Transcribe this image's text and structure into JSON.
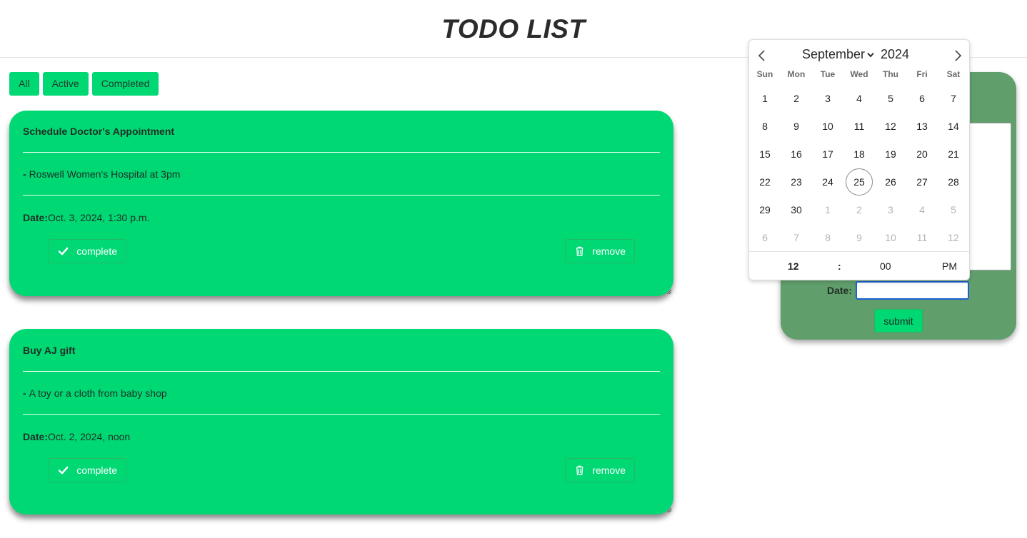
{
  "header": {
    "title": "TODO LIST"
  },
  "filters": [
    {
      "label": "All"
    },
    {
      "label": "Active"
    },
    {
      "label": "Completed"
    }
  ],
  "todos": [
    {
      "title": "Schedule Doctor's Appointment",
      "desc_prefix": "-",
      "desc": "Roswell Women's Hospital at 3pm",
      "date_label": "Date:",
      "date": "Oct. 3, 2024, 1:30 p.m.",
      "complete_label": "complete",
      "remove_label": "remove"
    },
    {
      "title": "Buy AJ gift",
      "desc_prefix": "-",
      "desc": "A toy or a cloth from baby shop",
      "date_label": "Date:",
      "date": "Oct. 2, 2024, noon",
      "complete_label": "complete",
      "remove_label": "remove"
    }
  ],
  "form": {
    "date_label": "Date:",
    "date_value": "",
    "submit_label": "submit"
  },
  "datepicker": {
    "month": "September",
    "year": "2024",
    "weekdays": [
      "Sun",
      "Mon",
      "Tue",
      "Wed",
      "Thu",
      "Fri",
      "Sat"
    ],
    "weeks": [
      [
        "1",
        "2",
        "3",
        "4",
        "5",
        "6",
        "7"
      ],
      [
        "8",
        "9",
        "10",
        "11",
        "12",
        "13",
        "14"
      ],
      [
        "15",
        "16",
        "17",
        "18",
        "19",
        "20",
        "21"
      ],
      [
        "22",
        "23",
        "24",
        "25",
        "26",
        "27",
        "28"
      ],
      [
        "29",
        "30",
        "1",
        "2",
        "3",
        "4",
        "5"
      ],
      [
        "6",
        "7",
        "8",
        "9",
        "10",
        "11",
        "12"
      ]
    ],
    "today": "25",
    "time": {
      "hour": "12",
      "separator": ":",
      "minute": "00",
      "ampm": "PM"
    }
  },
  "colors": {
    "card": "#00d874",
    "panel": "#609e6c",
    "focus": "#1f5fcf"
  }
}
